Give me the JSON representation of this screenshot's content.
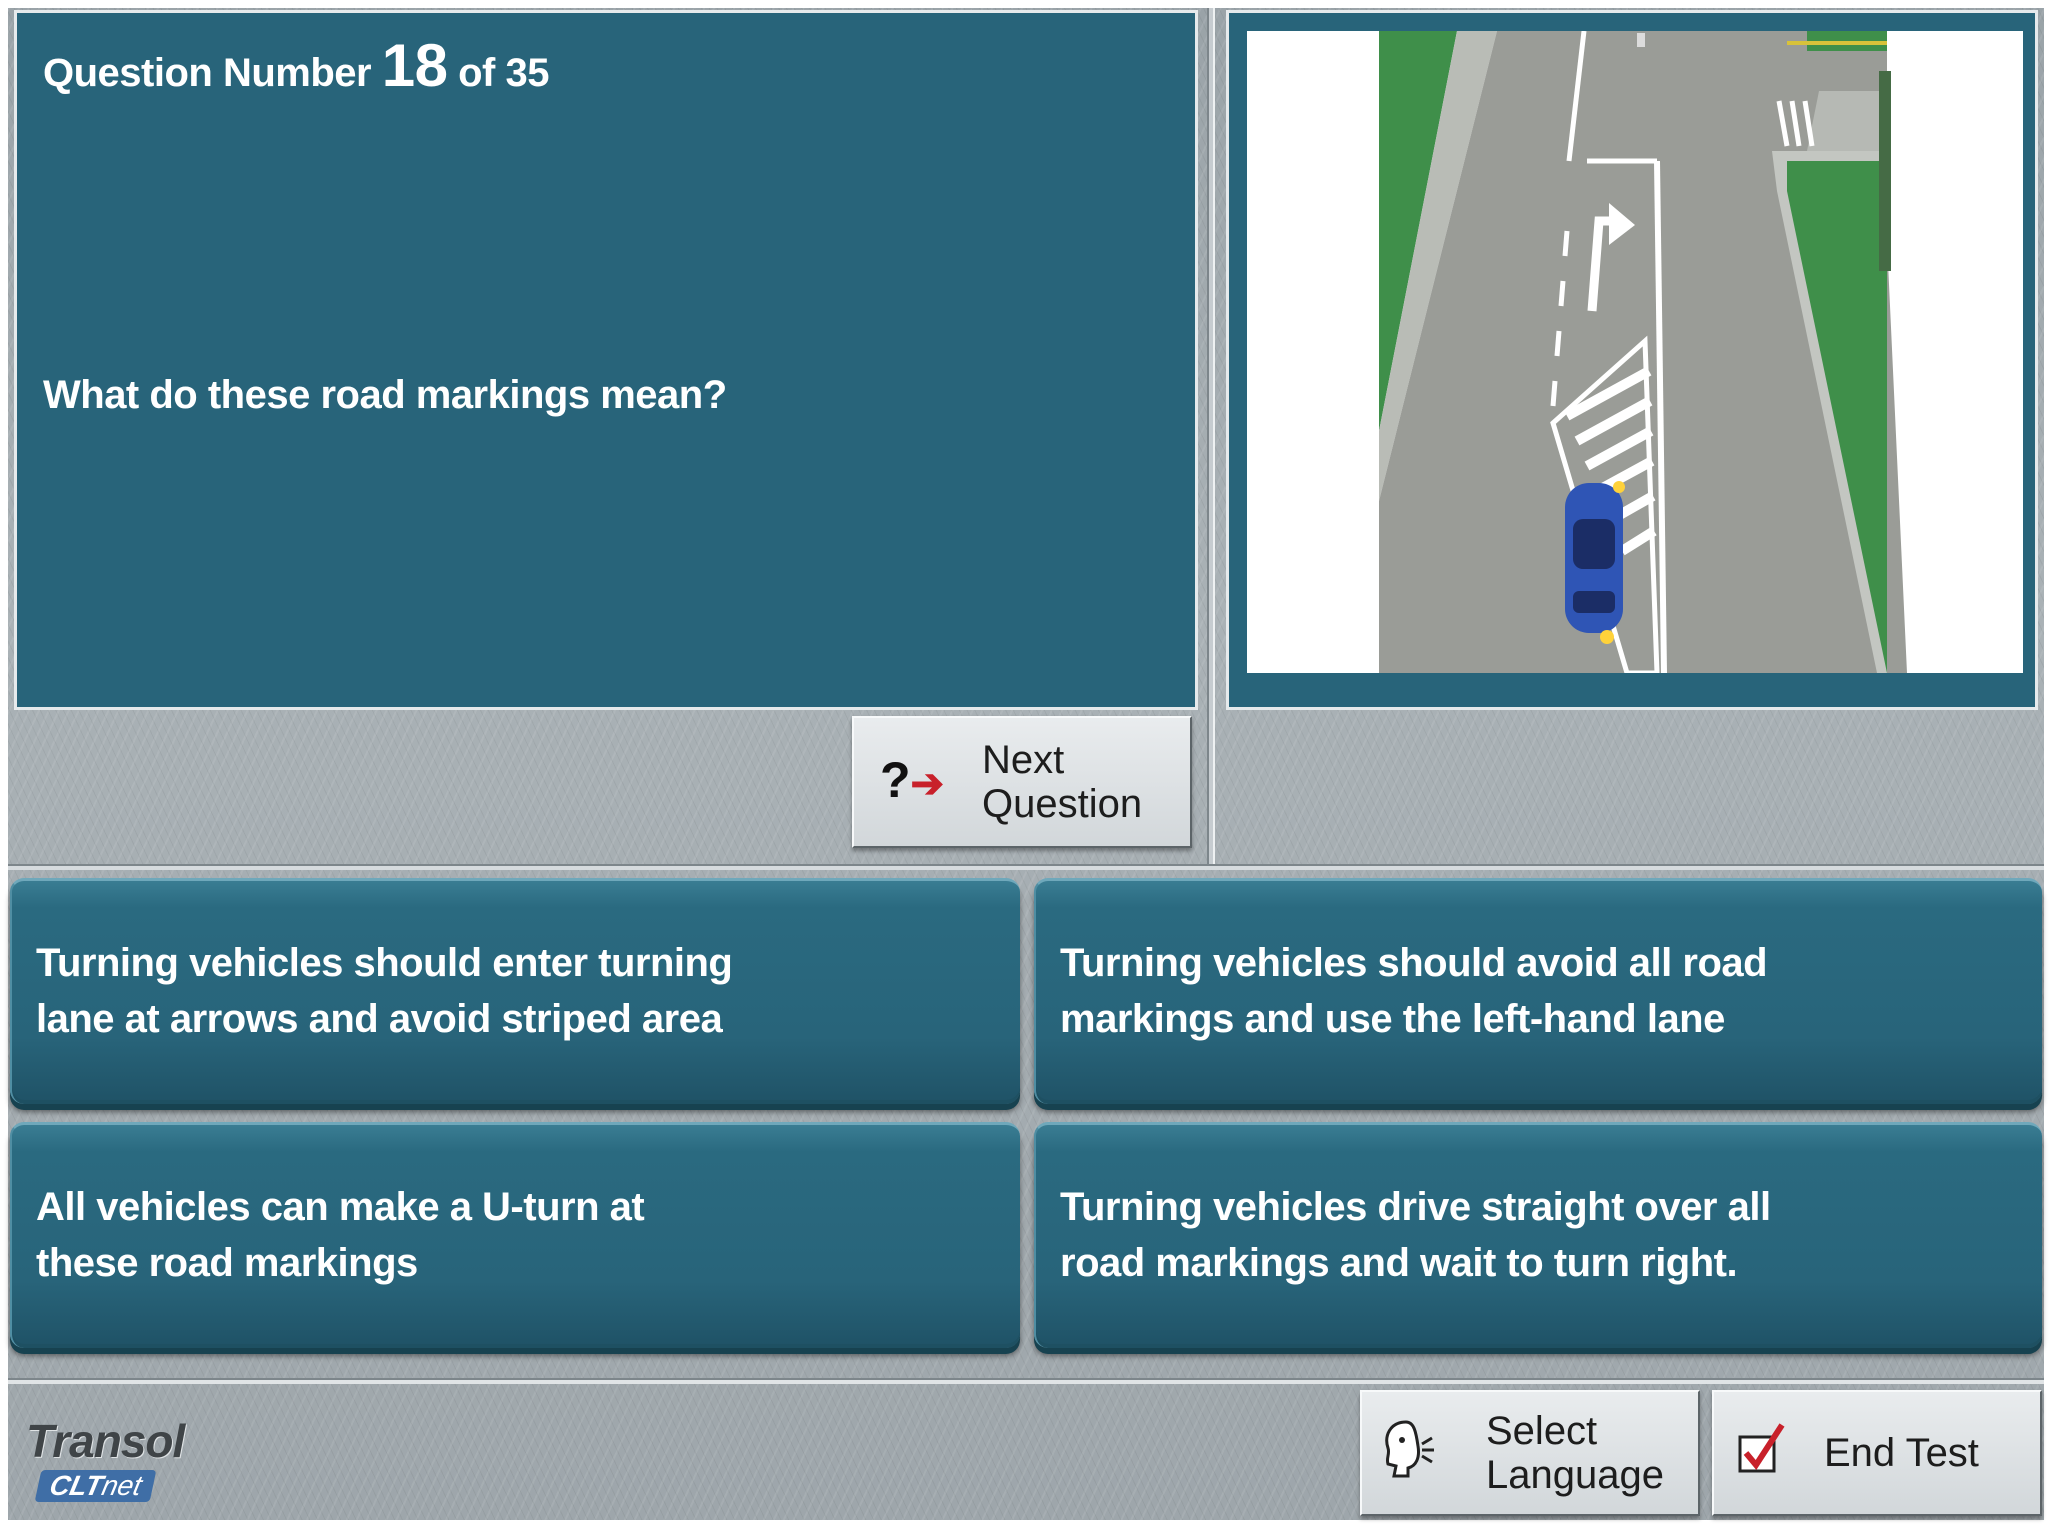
{
  "question": {
    "prefix": "Question Number",
    "number": "18",
    "suffix": "of 35",
    "text": "What do these road markings mean?"
  },
  "buttons": {
    "next_line1": "Next",
    "next_line2": "Question",
    "language_line1": "Select",
    "language_line2": "Language",
    "end_test": "End Test"
  },
  "answers": [
    {
      "line1": "Turning vehicles should enter turning",
      "line2": "lane at arrows and avoid striped area"
    },
    {
      "line1": "Turning vehicles should avoid all road",
      "line2": "markings and use the left-hand lane"
    },
    {
      "line1": "All vehicles can make a U-turn at",
      "line2": "these road markings"
    },
    {
      "line1": "Turning vehicles drive straight over all",
      "line2": "road markings and wait to turn right."
    }
  ],
  "logo": {
    "top": "Transol",
    "bottom_a": "CLT",
    "bottom_b": "net"
  },
  "colors": {
    "panel": "#28647a",
    "road": "#9a9c97",
    "grass": "#3f8f4a",
    "car": "#2f55b5"
  },
  "icons": [
    "question-arrow-icon",
    "speaker-head-icon",
    "checkmark-icon"
  ]
}
